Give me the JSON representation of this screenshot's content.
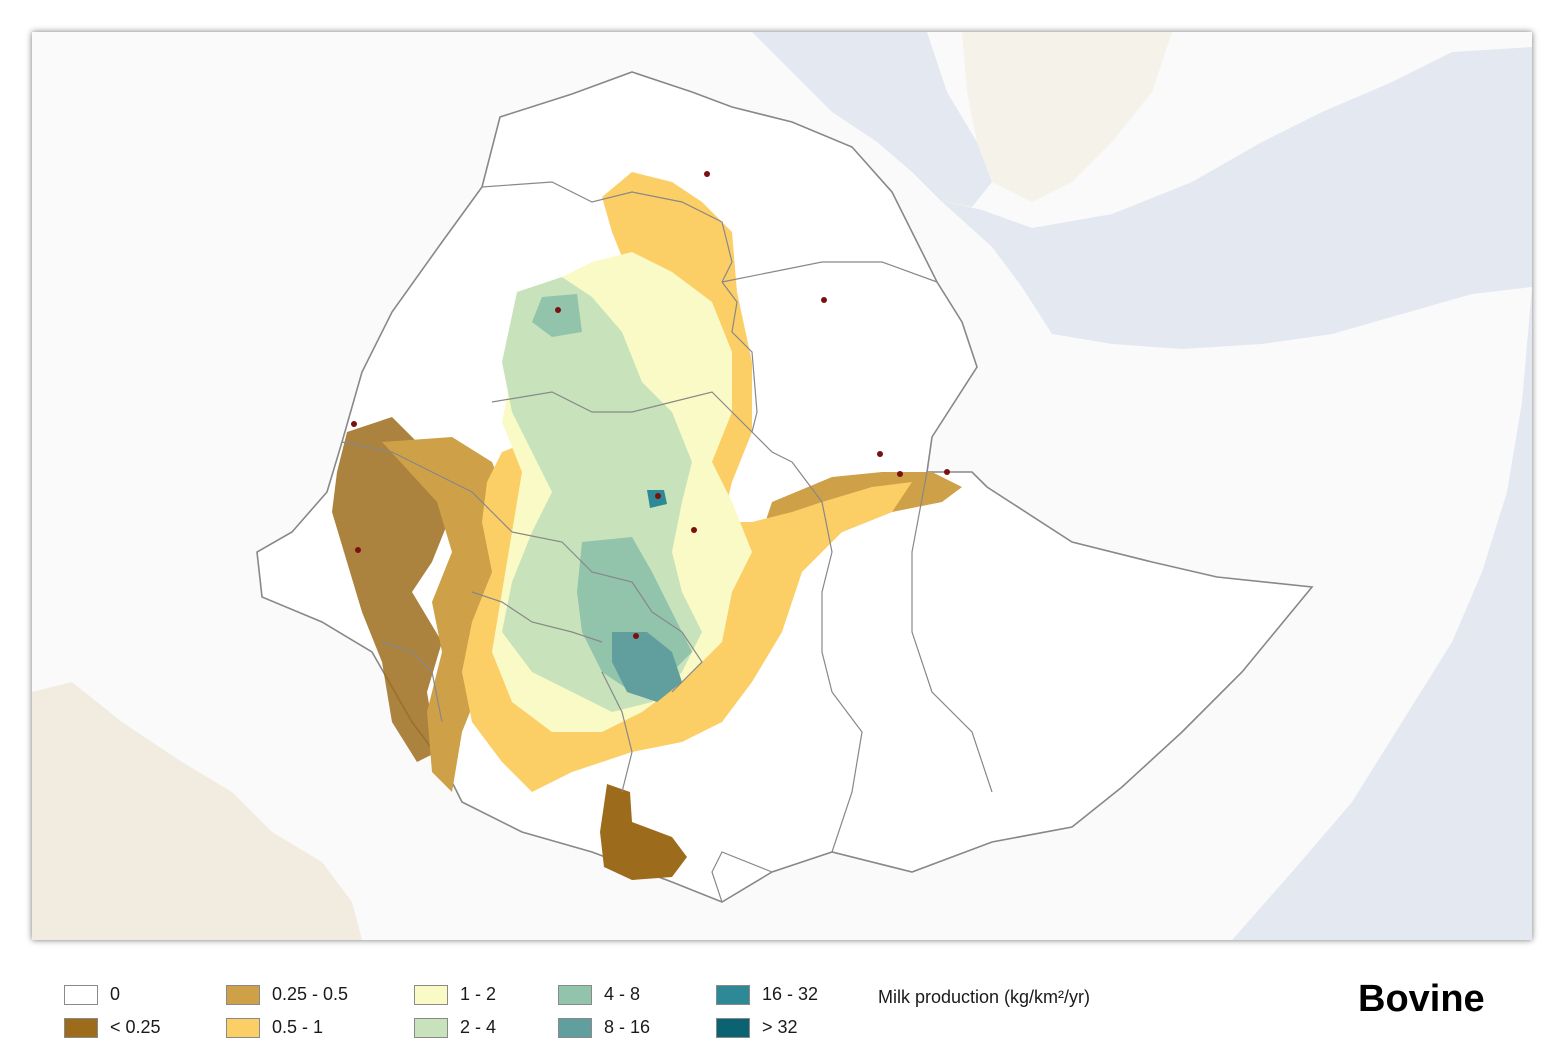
{
  "legend": {
    "title": "Milk production (kg/km²/yr)",
    "classes": [
      {
        "label": "0",
        "color": "#ffffff"
      },
      {
        "label": "< 0.25",
        "color": "#9c6c1c"
      },
      {
        "label": "0.25 - 0.5",
        "color": "#cea048"
      },
      {
        "label": "0.5 - 1",
        "color": "#fccf66"
      },
      {
        "label": "1 - 2",
        "color": "#fafac6"
      },
      {
        "label": "2 - 4",
        "color": "#c8e3bb"
      },
      {
        "label": "4 - 8",
        "color": "#92c3ab"
      },
      {
        "label": "8 - 16",
        "color": "#619f9f"
      },
      {
        "label": "16 - 32",
        "color": "#2c8995"
      },
      {
        "label": "> 32",
        "color": "#0a6272"
      }
    ]
  },
  "species": "Bovine",
  "map": {
    "sea_color": "#e4e9f1",
    "land_color": "#fafafa",
    "boundary_color": "#888888",
    "city_marker_color": "#7a1010"
  }
}
